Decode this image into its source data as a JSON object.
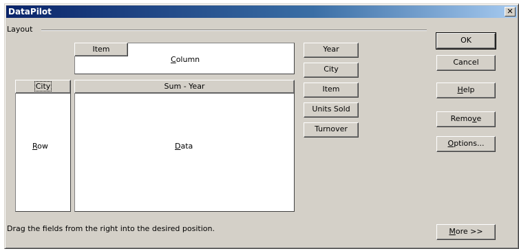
{
  "window": {
    "title": "DataPilot"
  },
  "layout": {
    "group_label": "Layout",
    "column_area": {
      "label_pre": "",
      "label_mnemonic": "C",
      "label_post": "olumn",
      "fields": [
        "Item"
      ]
    },
    "row_area": {
      "label_pre": "",
      "label_mnemonic": "R",
      "label_post": "ow",
      "fields": [
        "City"
      ]
    },
    "data_area": {
      "label_pre": "",
      "label_mnemonic": "D",
      "label_post": "ata",
      "fields": [
        "Sum - Year"
      ]
    }
  },
  "available_fields": [
    "Year",
    "City",
    "Item",
    "Units Sold",
    "Turnover"
  ],
  "buttons": {
    "ok": "OK",
    "cancel": "Cancel",
    "help_mnemonic": "H",
    "help_rest": "elp",
    "remove_pre": "Remo",
    "remove_mnemonic": "v",
    "remove_post": "e",
    "options_mnemonic": "O",
    "options_rest": "ptions...",
    "more_mnemonic": "M",
    "more_rest": "ore >>"
  },
  "hint": "Drag the fields from the right into the desired position."
}
